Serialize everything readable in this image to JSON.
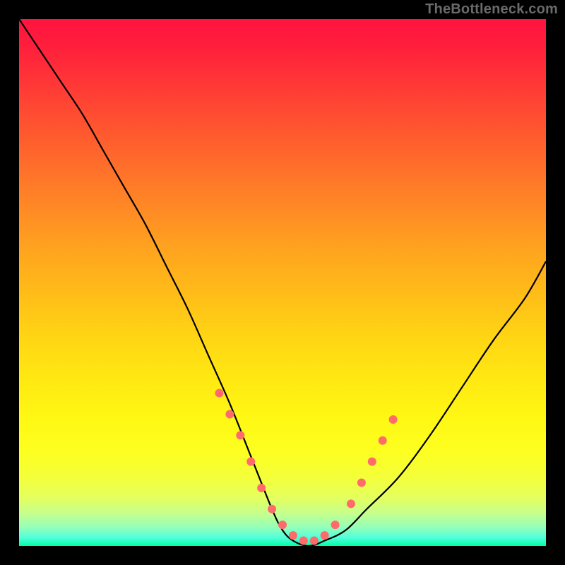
{
  "chart_data": {
    "type": "line",
    "title": "",
    "watermark": "TheBottleneck.com",
    "xlabel": "",
    "ylabel": "",
    "xlim": [
      0,
      100
    ],
    "ylim": [
      0,
      100
    ],
    "grid": false,
    "legend": false,
    "curve": {
      "name": "bottleneck",
      "color": "#000000",
      "x": [
        0,
        4,
        8,
        12,
        16,
        20,
        24,
        28,
        32,
        36,
        40,
        44,
        48,
        50,
        52,
        55,
        58,
        62,
        66,
        72,
        78,
        84,
        90,
        96,
        100
      ],
      "y": [
        100,
        94,
        88,
        82,
        75,
        68,
        61,
        53,
        45,
        36,
        27,
        17,
        7,
        3,
        1,
        0,
        1,
        3,
        7,
        13,
        21,
        30,
        39,
        47,
        54
      ]
    },
    "left_segment_comment": "steep near-linear descent with slight outward bow",
    "right_segment_comment": "shallower convex ascent",
    "markers": {
      "color": "#ff6b6b",
      "radius_px": 6,
      "points": [
        {
          "x": 38,
          "y": 29
        },
        {
          "x": 40,
          "y": 25
        },
        {
          "x": 42,
          "y": 21
        },
        {
          "x": 44,
          "y": 16
        },
        {
          "x": 46,
          "y": 11
        },
        {
          "x": 48,
          "y": 7
        },
        {
          "x": 50,
          "y": 4
        },
        {
          "x": 52,
          "y": 2
        },
        {
          "x": 54,
          "y": 1
        },
        {
          "x": 56,
          "y": 1
        },
        {
          "x": 58,
          "y": 2
        },
        {
          "x": 60,
          "y": 4
        },
        {
          "x": 63,
          "y": 8
        },
        {
          "x": 65,
          "y": 12
        },
        {
          "x": 67,
          "y": 16
        },
        {
          "x": 69,
          "y": 20
        },
        {
          "x": 71,
          "y": 24
        }
      ]
    },
    "gradient_stops": [
      {
        "pos": 0.0,
        "color": "#ff143e"
      },
      {
        "pos": 0.5,
        "color": "#ffcf14"
      },
      {
        "pos": 0.82,
        "color": "#fdff20"
      },
      {
        "pos": 1.0,
        "color": "#00ffa0"
      }
    ]
  }
}
